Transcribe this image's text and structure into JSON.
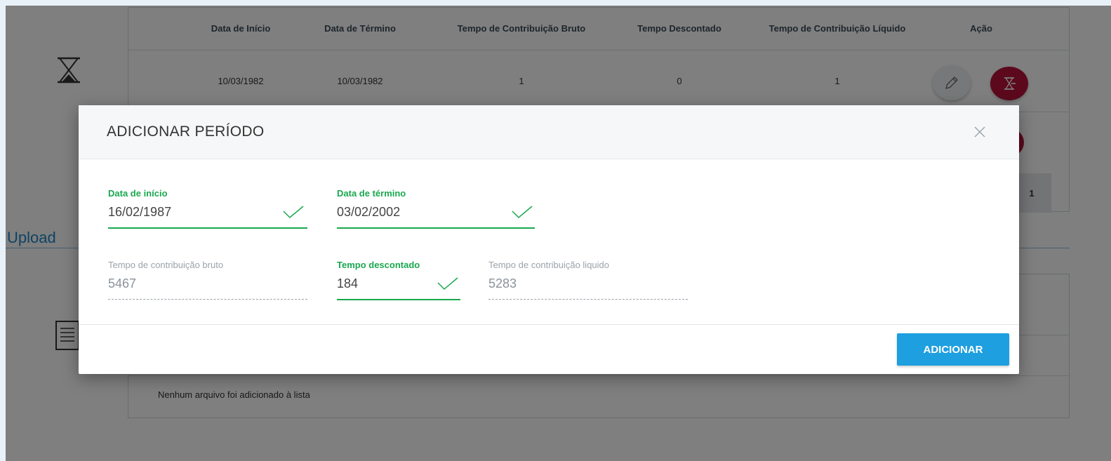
{
  "background": {
    "periods_table": {
      "columns": [
        "Data de Início",
        "Data de Término",
        "Tempo de Contribuição Bruto",
        "Tempo Descontado",
        "Tempo de Contribuição Líquido",
        "Ação"
      ],
      "rows": [
        {
          "start": "10/03/1982",
          "end": "10/03/1982",
          "gross": "1",
          "discounted": "0",
          "net": "1"
        }
      ],
      "pagination_page": "1"
    },
    "upload": {
      "title": "Upload",
      "empty_message": "Nenhum arquivo foi adicionado à lista"
    },
    "icons": [
      "hourglass-icon",
      "pencil-icon",
      "hourglass-remove-icon",
      "document-list-icon"
    ],
    "colors": {
      "remove_button": "#b8123b"
    }
  },
  "modal": {
    "title": "ADICIONAR PERÍODO",
    "close_icon": "close-icon",
    "fields": {
      "start_date": {
        "label": "Data de início",
        "value": "16/02/1987"
      },
      "end_date": {
        "label": "Data de término",
        "value": "03/02/2002"
      },
      "gross_time": {
        "label": "Tempo de contribuição bruto",
        "value": "5467"
      },
      "discounted_time": {
        "label": "Tempo descontado",
        "value": "184"
      },
      "net_time": {
        "label": "Tempo de contribuição liquido",
        "value": "5283"
      }
    },
    "submit_label": "ADICIONAR",
    "colors": {
      "valid": "#1aa84f",
      "primary_button": "#1d9fe0"
    }
  }
}
